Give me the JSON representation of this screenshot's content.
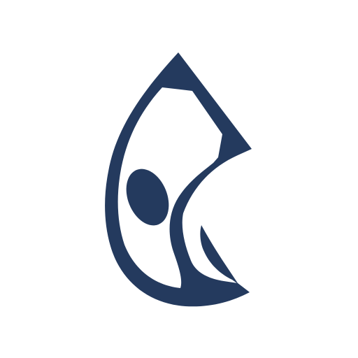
{
  "logo": {
    "icon_name": "stylized-money-bill-logo-icon",
    "color": "#243a5e",
    "background": "#ffffff"
  }
}
